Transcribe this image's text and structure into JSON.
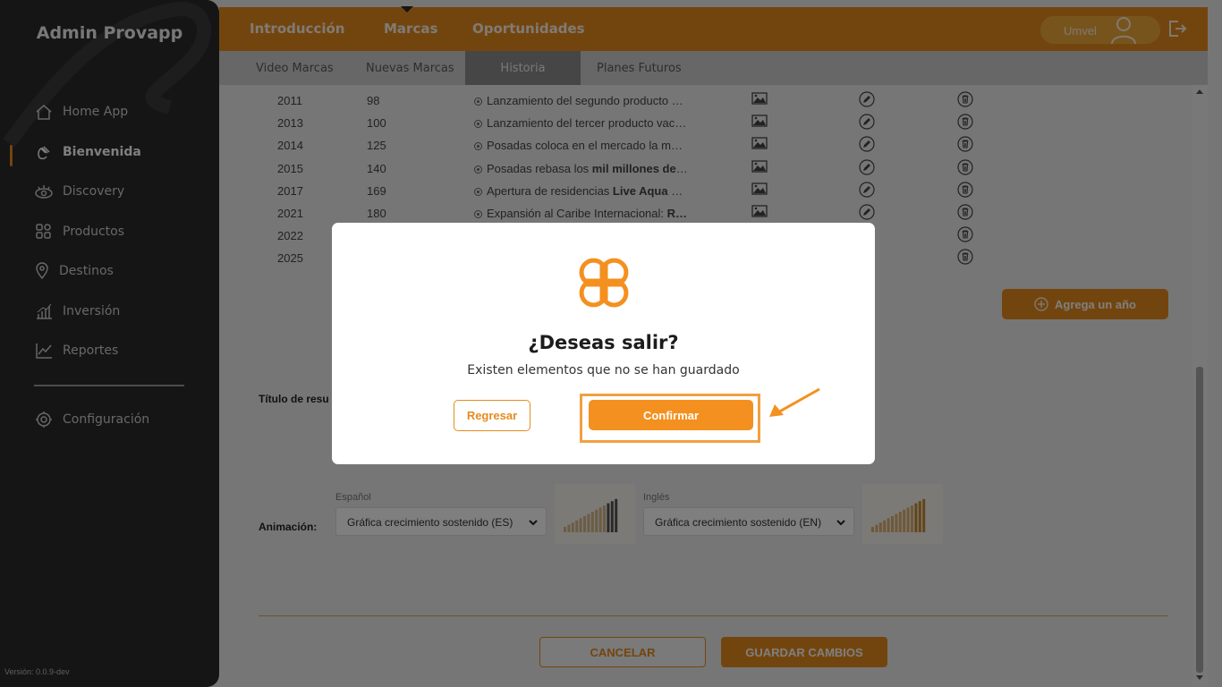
{
  "sidebar": {
    "brand": "Admin Provapp",
    "items": [
      {
        "label": "Home App",
        "icon": "home-icon"
      },
      {
        "label": "Bienvenida",
        "icon": "wave-hand-icon"
      },
      {
        "label": "Discovery",
        "icon": "eye-icon"
      },
      {
        "label": "Productos",
        "icon": "grid-icon"
      },
      {
        "label": "Destinos",
        "icon": "location-pin-icon"
      },
      {
        "label": "Inversión",
        "icon": "bar-chart-icon"
      },
      {
        "label": "Reportes",
        "icon": "trend-chart-icon"
      }
    ],
    "settings_label": "Configuración",
    "version": "Versión: 0.0.9-dev"
  },
  "topbar": {
    "tabs": [
      "Introducción",
      "Marcas",
      "Oportunidades"
    ],
    "active_tab": "Marcas",
    "user_name": "Umvel"
  },
  "subtabs": {
    "items": [
      "Video Marcas",
      "Nuevas Marcas",
      "Historia",
      "Planes Futuros"
    ],
    "active": "Historia"
  },
  "history_rows": [
    {
      "year": "2011",
      "value": "98",
      "description": "Lanzamiento del segundo producto v…",
      "bold": ""
    },
    {
      "year": "2013",
      "value": "100",
      "description": "Lanzamiento del tercer producto vac…",
      "bold": ""
    },
    {
      "year": "2014",
      "value": "125",
      "description": "Posadas coloca en el mercado la ma…",
      "bold": ""
    },
    {
      "year": "2015",
      "value": "140",
      "description": "Posadas rebasa los ",
      "bold": "mil millones de …"
    },
    {
      "year": "2017",
      "value": "169",
      "description": "Apertura de residencias ",
      "bold": "Live Aqua R…"
    },
    {
      "year": "2021",
      "value": "180",
      "description": "Expansión al Caribe Internacional: ",
      "bold": "R…"
    },
    {
      "year": "2022",
      "value": "",
      "description": "",
      "bold": ""
    },
    {
      "year": "2025",
      "value": "",
      "description": "",
      "bold": ""
    }
  ],
  "content": {
    "add_year_label": "Agrega un año",
    "resumen_label": "Título de resu",
    "animation_label": "Animación:",
    "spanish_label": "Español",
    "english_label": "Inglés",
    "spanish_select": "Gráfica crecimiento sostenido (ES)",
    "english_select": "Gráfica crecimiento sostenido (EN)",
    "cancel_label": "CANCELAR",
    "save_label": "GUARDAR CAMBIOS"
  },
  "modal": {
    "title": "¿Deseas salir?",
    "message": "Existen elementos que no se han guardado",
    "back_label": "Regresar",
    "confirm_label": "Confirmar"
  },
  "colors": {
    "accent": "#e78b1d",
    "sidebar_bg": "#2b2b2b",
    "subtab_bg": "#cfcfcf",
    "active_subtab_bg": "#8d8d8d"
  }
}
